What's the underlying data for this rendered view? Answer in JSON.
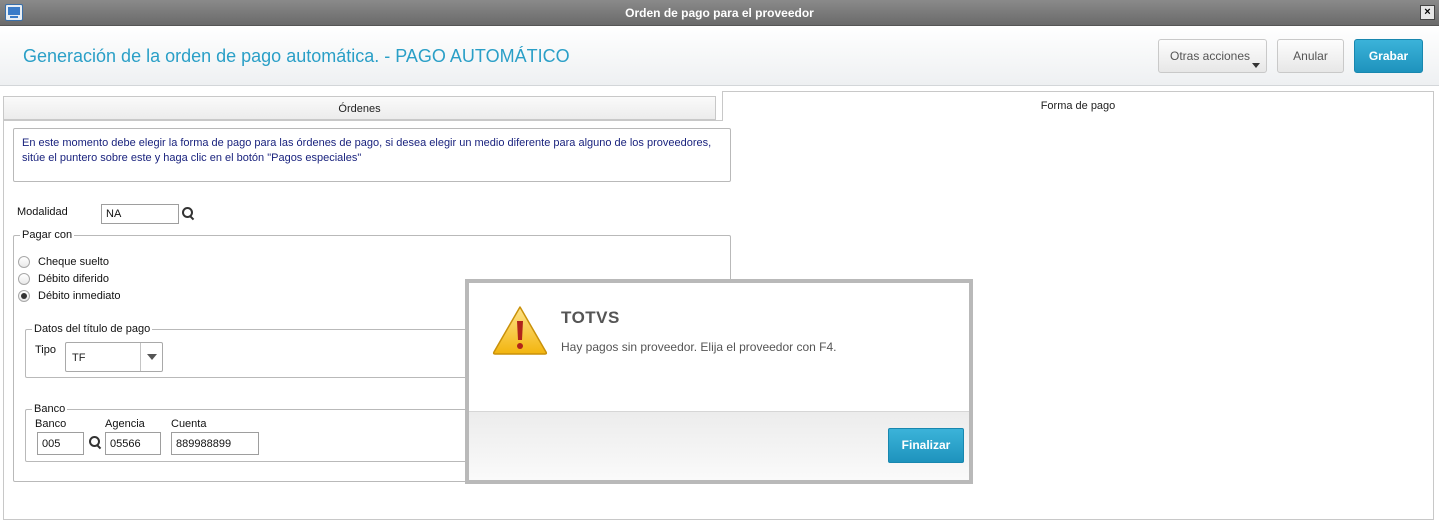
{
  "window": {
    "title": "Orden de pago para el proveedor",
    "close_glyph": "×"
  },
  "header": {
    "page_title": "Generación de la orden de pago automática. - PAGO AUTOMÁTICO",
    "buttons": {
      "otras": "Otras acciones",
      "anular": "Anular",
      "grabar": "Grabar"
    }
  },
  "tabs": [
    {
      "label": "Órdenes"
    },
    {
      "label": "Forma de pago",
      "active": true
    }
  ],
  "info_text": "En este momento debe elegir la forma de pago para las órdenes de pago, si desea elegir un medio diferente para alguno de los proveedores, sitúe el puntero sobre este y haga clic en el botón \"Pagos especiales\"",
  "form": {
    "modalidad": {
      "label": "Modalidad",
      "value": "NA"
    },
    "pagar_con": {
      "legend": "Pagar con",
      "options": [
        {
          "label": "Cheque suelto",
          "checked": false
        },
        {
          "label": "Débito diferido",
          "checked": false
        },
        {
          "label": "Débito inmediato",
          "checked": true
        }
      ]
    },
    "datos_titulo": {
      "legend": "Datos del título de pago",
      "tipo_label": "Tipo",
      "tipo_value": "TF"
    },
    "banco": {
      "legend": "Banco",
      "banco_label": "Banco",
      "banco_value": "005",
      "agencia_label": "Agencia",
      "agencia_value": "05566",
      "cuenta_label": "Cuenta",
      "cuenta_value": "889988899"
    }
  },
  "dialog": {
    "title": "TOTVS",
    "message": "Hay pagos sin proveedor. Elija el proveedor con F4.",
    "button": "Finalizar",
    "icon": "warning-icon"
  },
  "colors": {
    "accent": "#2a9fc7",
    "primary_button": "#1e93bd",
    "info_text": "#1a237e"
  }
}
